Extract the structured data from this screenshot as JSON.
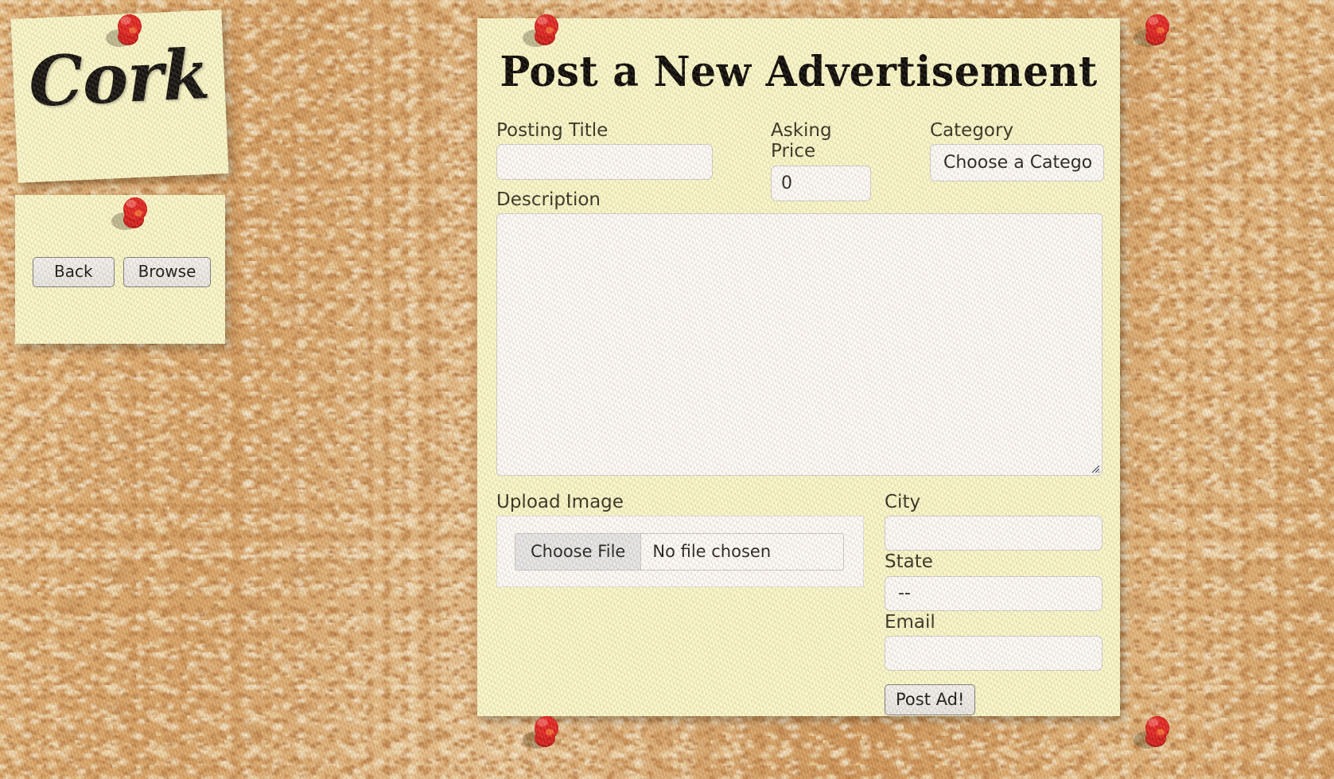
{
  "board": {
    "cork_note": {
      "word": "Cork"
    },
    "nav_note": {
      "back_label": "Back",
      "browse_label": "Browse"
    }
  },
  "form": {
    "title": "Post a New Advertisement",
    "posting_title": {
      "label": "Posting Title",
      "value": "",
      "placeholder": ""
    },
    "asking_price": {
      "label": "Asking Price",
      "value": "0",
      "placeholder": ""
    },
    "category": {
      "label": "Category",
      "selected": "Choose a Category"
    },
    "description": {
      "label": "Description",
      "value": "",
      "placeholder": ""
    },
    "upload_image": {
      "label": "Upload Image",
      "choose_file_label": "Choose File",
      "file_status": "No file chosen"
    },
    "city": {
      "label": "City",
      "value": "",
      "placeholder": ""
    },
    "state": {
      "label": "State",
      "selected": "--"
    },
    "email": {
      "label": "Email",
      "value": "",
      "placeholder": ""
    },
    "submit_label": "Post Ad!"
  },
  "colors": {
    "note_paper": "#fbfbcd",
    "pin_red": "#d81414",
    "cork_base": "#d9a96b",
    "label_text": "#2b2b1e",
    "control_border": "#cfcfcf"
  },
  "icons": {
    "pushpin": "pushpin-icon",
    "resize_handle": "resize-handle-icon"
  }
}
